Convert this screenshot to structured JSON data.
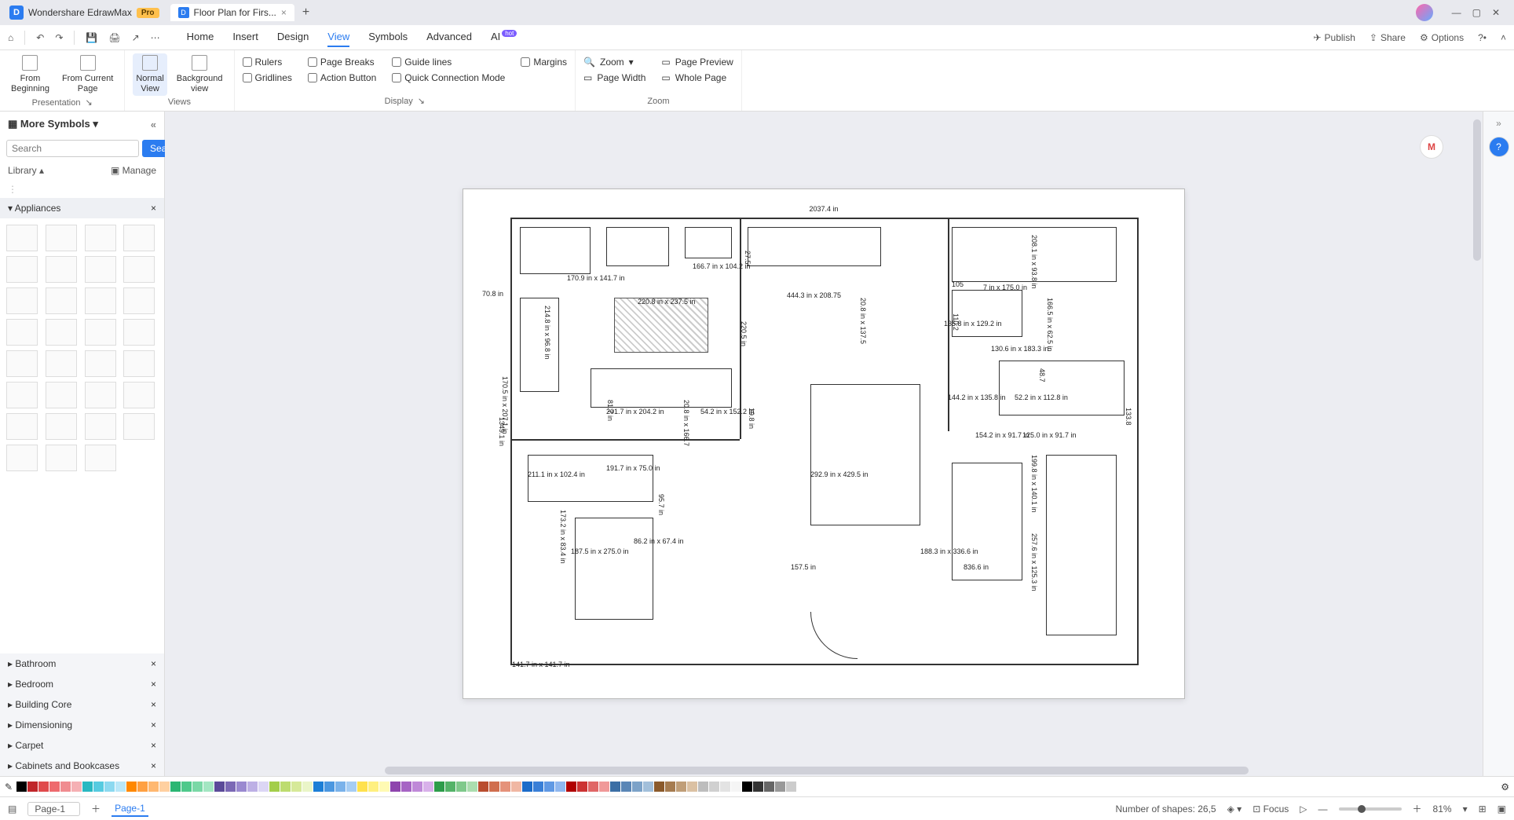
{
  "titlebar": {
    "app_name": "Wondershare EdrawMax",
    "pro": "Pro",
    "doc_tab": "Floor Plan for Firs...",
    "close": "×",
    "add": "+"
  },
  "menu": {
    "home": "Home",
    "insert": "Insert",
    "design": "Design",
    "view": "View",
    "symbols": "Symbols",
    "advanced": "Advanced",
    "ai": "AI",
    "hot": "hot"
  },
  "right_actions": {
    "publish": "Publish",
    "share": "Share",
    "options": "Options"
  },
  "ribbon": {
    "from_beginning": "From\nBeginning",
    "from_current": "From Current\nPage",
    "presentation": "Presentation",
    "normal_view": "Normal\nView",
    "background_view": "Background\nview",
    "views": "Views",
    "rulers": "Rulers",
    "page_breaks": "Page Breaks",
    "guide_lines": "Guide lines",
    "margins": "Margins",
    "gridlines": "Gridlines",
    "action_button": "Action Button",
    "quick_conn": "Quick Connection Mode",
    "display": "Display",
    "zoom": "Zoom",
    "page_width": "Page Width",
    "page_preview": "Page Preview",
    "whole_page": "Whole Page",
    "zoom_label": "Zoom"
  },
  "left": {
    "more_symbols": "More Symbols",
    "search_ph": "Search",
    "search_btn": "Search",
    "library": "Library",
    "manage": "Manage",
    "cats": {
      "appliances": "Appliances",
      "bathroom": "Bathroom",
      "bedroom": "Bedroom",
      "building_core": "Building Core",
      "dimensioning": "Dimensioning",
      "carpet": "Carpet",
      "cabinets": "Cabinets and Bookcases"
    }
  },
  "canvas": {
    "top_dim": "2037.4 in",
    "left_dim": "1349.1 in",
    "d1": "170.9 in x 141.7 in",
    "d2": "166.7 in x 104.2 in",
    "d3": "444.3 in x 208.75",
    "d4": "208.1 in x 93.8 in",
    "d5": "7 in x 175.0 in",
    "d6": "214.8 in x 96.8 in",
    "d7": "220.8 in x 237.5 in",
    "d8": "135.8 in x 129.2 in",
    "d9": "166.5 in x 62.5 in",
    "d10": "130.6 in x 183.3 in",
    "d11": "201.7 in x 204.2 in",
    "d12": "144.2 in x 135.8 in",
    "d13": "154.2 in x 91.7 in",
    "d14": "125.0 in x 91.7 in",
    "d15": "191.7 in x 75.0 in",
    "d16": "211.1 in x 102.4 in",
    "d17": "173.2 in x 83.4 in",
    "d18": "187.5 in x 275.0 in",
    "d19": "86.2 in x 67.4 in",
    "d20": "292.9 in x 429.5 in",
    "d21": "188.3 in x 336.6 in",
    "d22": "157.5 in",
    "d23": "836.6 in",
    "d24": "141.7 in x 141.7 in",
    "d25": "70.8 in",
    "d26": "27.5",
    "d27": "20.8 in x 137.5",
    "d28": "220.5 in",
    "d29": "170.5 in x 207.1 in",
    "d30": "20.8 in x 166.7",
    "d31": "95.7 in",
    "d32": "199.8 in x 140.1 in",
    "d33": "257.6 in x 125.3 in",
    "d34": "110.2",
    "d35": "105",
    "d36": "81.7 in",
    "d37": "54.2 in x 152.2 in",
    "d38": "19.8 in",
    "d39": "133.8",
    "d40": "52.2 in x 112.8 in",
    "d41": "48.7"
  },
  "status": {
    "page_dd": "Page-1",
    "page_tab": "Page-1",
    "shapes_label": "Number of shapes:",
    "shapes_count": "26,5",
    "focus": "Focus",
    "zoom_pct": "81%"
  },
  "colors": [
    "#000",
    "#c0262a",
    "#e04a4c",
    "#ee6a6e",
    "#f08c90",
    "#f5b0b4",
    "#29b8c1",
    "#56cbe0",
    "#8cd9f0",
    "#b9e7f8",
    "#ff8800",
    "#ffa042",
    "#ffb870",
    "#ffd0a0",
    "#2bb673",
    "#4fc98b",
    "#7ad8a6",
    "#a3e6c2",
    "#5b4a99",
    "#7b68b5",
    "#9a89d0",
    "#bdb0e5",
    "#dcd6f5",
    "#a3ce4a",
    "#bddc6f",
    "#d6e999",
    "#eaf5c8",
    "#1c7ed6",
    "#4b97e0",
    "#7ab2ea",
    "#a6cdf3",
    "#ffe14d",
    "#fff080",
    "#fffab3",
    "#8e44ad",
    "#a664c4",
    "#bf89d8",
    "#d8b1ea",
    "#2d9c4a",
    "#54b368",
    "#7fc98b",
    "#abddaf",
    "#b94d2f",
    "#d06e4e",
    "#e5927a",
    "#f0b7a3",
    "#1b6bc9",
    "#397fd7",
    "#6099e4",
    "#8fb7ef",
    "#b00000",
    "#cc3333",
    "#e06666",
    "#f09999",
    "#3c6fa5",
    "#5a86b6",
    "#7ca2c8",
    "#a2bfda",
    "#8b5a2b",
    "#a67c50",
    "#c09e78",
    "#dbc1a3",
    "#bdbdbd",
    "#d0d0d0",
    "#e3e3e3",
    "#f5f5f5",
    "#000",
    "#333",
    "#666",
    "#999",
    "#ccc",
    "#fff"
  ]
}
